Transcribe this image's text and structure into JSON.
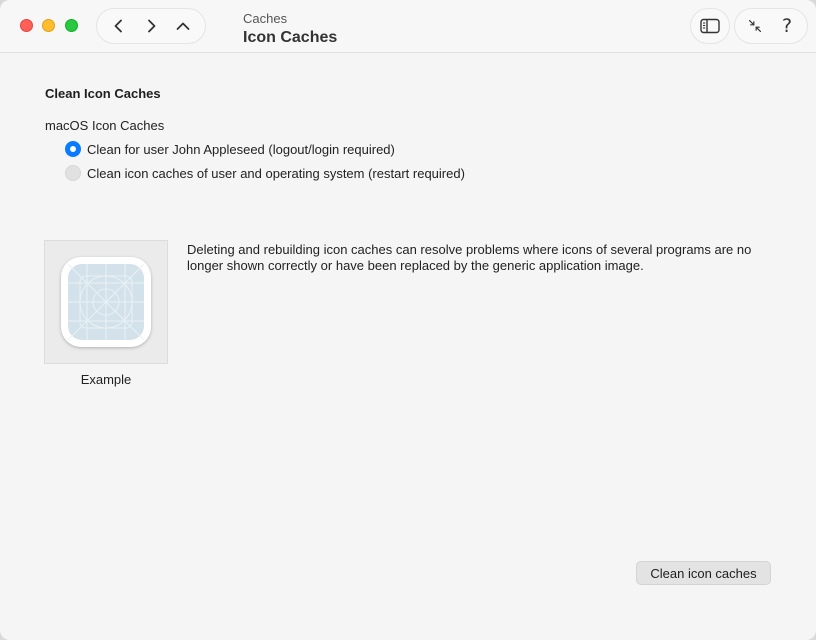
{
  "window": {
    "breadcrumb": "Caches",
    "title": "Icon Caches"
  },
  "toolbar": {
    "nav_icons": [
      "chevron-left-icon",
      "chevron-right-icon",
      "chevron-up-icon"
    ],
    "sidebar_icon": "sidebar-icon",
    "collapse_icon": "arrows-collapse-icon",
    "help_label": "?"
  },
  "content": {
    "section_title": "Clean Icon Caches",
    "group_label": "macOS Icon Caches",
    "options": [
      {
        "label": "Clean for user John Appleseed (logout/login required)",
        "selected": true
      },
      {
        "label": "Clean icon caches of user and operating system (restart required)",
        "selected": false
      }
    ],
    "example_label": "Example",
    "description": "Deleting and rebuilding icon caches can resolve problems where icons of several programs are no longer shown correctly or have been replaced by the generic application image.",
    "action_button": "Clean icon caches"
  },
  "colors": {
    "accent": "#0a7bff",
    "close": "#fe5f57",
    "minimize": "#febc2e",
    "maximize": "#28c840",
    "icon_placeholder": "#d3e2ea"
  }
}
